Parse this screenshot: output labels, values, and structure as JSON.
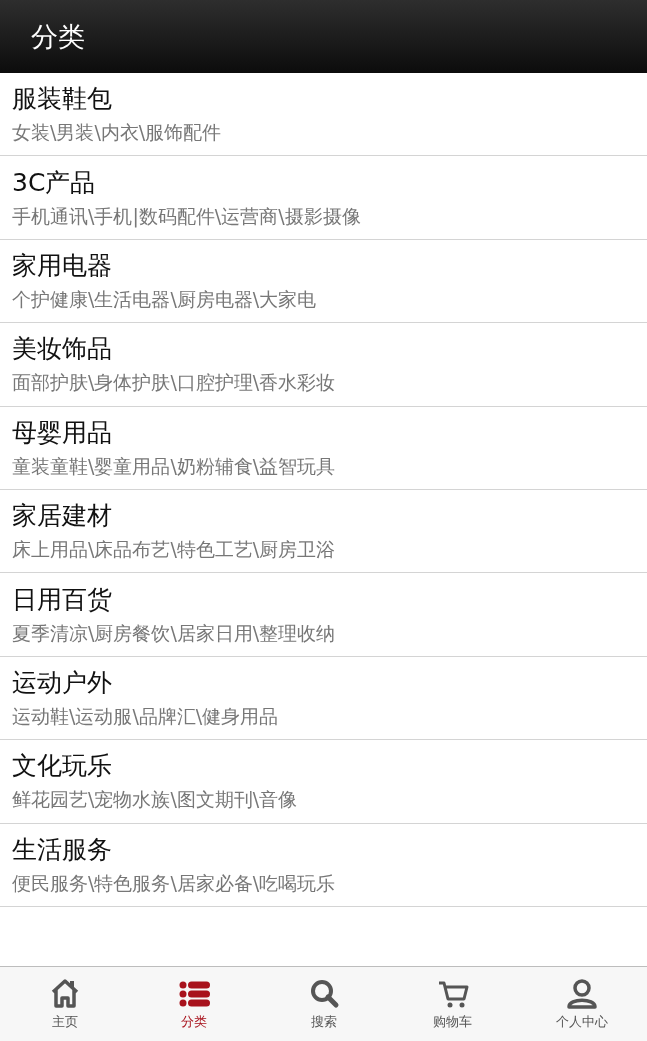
{
  "header": {
    "title": "分类"
  },
  "categories": [
    {
      "name": "服装鞋包",
      "subtitle": "女装\\男装\\内衣\\服饰配件"
    },
    {
      "name": "3C产品",
      "subtitle": "手机通讯\\手机|数码配件\\运营商\\摄影摄像"
    },
    {
      "name": "家用电器",
      "subtitle": "个护健康\\生活电器\\厨房电器\\大家电"
    },
    {
      "name": "美妆饰品",
      "subtitle": "面部护肤\\身体护肤\\口腔护理\\香水彩妆"
    },
    {
      "name": "母婴用品",
      "subtitle": "童装童鞋\\婴童用品\\奶粉辅食\\益智玩具"
    },
    {
      "name": "家居建材",
      "subtitle": "床上用品\\床品布艺\\特色工艺\\厨房卫浴"
    },
    {
      "name": "日用百货",
      "subtitle": "夏季清凉\\厨房餐饮\\居家日用\\整理收纳"
    },
    {
      "name": "运动户外",
      "subtitle": "运动鞋\\运动服\\品牌汇\\健身用品"
    },
    {
      "name": "文化玩乐",
      "subtitle": "鲜花园艺\\宠物水族\\图文期刊\\音像"
    },
    {
      "name": "生活服务",
      "subtitle": "便民服务\\特色服务\\居家必备\\吃喝玩乐"
    }
  ],
  "tab_bar": [
    {
      "label": "主页",
      "kind": "home",
      "selected": false
    },
    {
      "label": "分类",
      "kind": "list",
      "selected": true
    },
    {
      "label": "搜索",
      "kind": "search",
      "selected": false
    },
    {
      "label": "购物车",
      "kind": "cart",
      "selected": false
    },
    {
      "label": "个人中心",
      "kind": "user",
      "selected": false
    }
  ]
}
